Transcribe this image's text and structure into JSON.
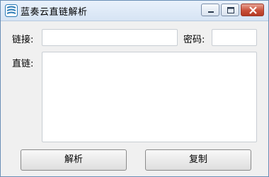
{
  "window": {
    "title": "蓝奏云直链解析"
  },
  "form": {
    "link_label": "链接:",
    "link_value": "",
    "password_label": "密码:",
    "password_value": "",
    "direct_label": "直链:",
    "direct_value": ""
  },
  "buttons": {
    "parse": "解析",
    "copy": "复制"
  },
  "icons": {
    "app": "app-logo-icon",
    "minimize": "minimize-icon",
    "maximize": "maximize-icon",
    "close": "close-icon"
  },
  "colors": {
    "close_button": "#c9503a",
    "app_icon": "#2c7bb6"
  }
}
